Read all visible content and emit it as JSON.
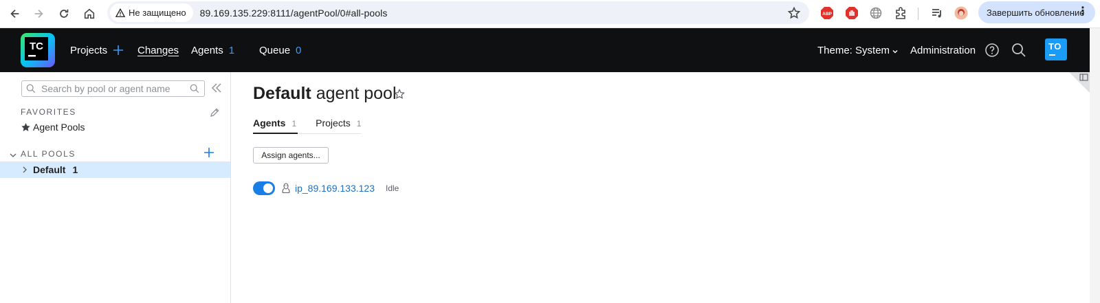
{
  "browser": {
    "security_label": "Не защищено",
    "url": "89.169.135.229:8111/agentPool/0#all-pools",
    "update_label": "Завершить обновление"
  },
  "header": {
    "projects_label": "Projects",
    "changes_label": "Changes",
    "agents_label": "Agents",
    "agents_count": "1",
    "queue_label": "Queue",
    "queue_count": "0",
    "theme_label": "Theme: System",
    "administration_label": "Administration",
    "avatar_initials": "TO",
    "logo_text": "TC"
  },
  "sidebar": {
    "search_placeholder": "Search by pool or agent name",
    "favorites_title": "FAVORITES",
    "favorites": [
      {
        "label": "Agent Pools"
      }
    ],
    "all_pools_title": "ALL POOLS",
    "pools": [
      {
        "name": "Default",
        "count": "1"
      }
    ]
  },
  "main": {
    "title_strong": "Default",
    "title_rest": "agent pool",
    "tabs": [
      {
        "label": "Agents",
        "count": "1",
        "active": true
      },
      {
        "label": "Projects",
        "count": "1",
        "active": false
      }
    ],
    "assign_button": "Assign agents...",
    "agents": [
      {
        "name": "ip_89.169.133.123",
        "status": "Idle",
        "enabled": true,
        "os_icon": "linux-icon"
      }
    ]
  },
  "colors": {
    "header_bg": "#0f1012",
    "accent": "#1a7fe5",
    "count_blue": "#3a9bff",
    "selected_row": "#d6ebfd",
    "avatar_bg": "#1a9bf5"
  }
}
